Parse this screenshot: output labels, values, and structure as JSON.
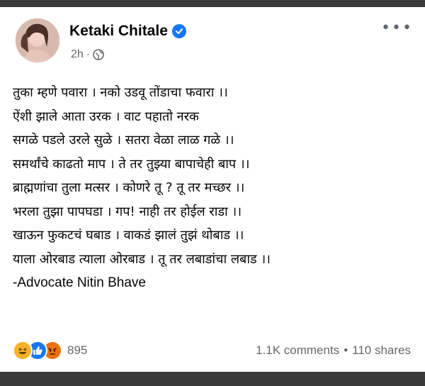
{
  "post": {
    "author": "Ketaki Chitale",
    "timestamp": "2h",
    "separator": "·",
    "more_label": "•••",
    "lines": [
      "तुका म्हणे पवारा । नको उडवू तोंडाचा फवारा ।।",
      "ऐंशी झाले आता उरक । वाट पहातो नरक",
      "सगळे पडले उरले सुळे । सतरा वेळा लाळ गळे ।।",
      "समर्थांचे काढतो माप । ते तर तुझ्या बापाचेही बाप ।।",
      "ब्राह्मणांचा तुला मत्सर । कोणरे तू ? तू तर  मच्छर ।।",
      "भरला तुझा पापघडा । गप! नाही तर होईल राडा ।।",
      "खाऊन  फुकटचं घबाड । वाकडं झालं तुझं थोबाड ।।",
      "याला ओरबाड त्याला ओरबाड ।  तू तर लबाडांचा लबाड ।।"
    ],
    "signature": "-Advocate Nitin Bhave"
  },
  "footer": {
    "reaction_count": "895",
    "comments": "1.1K comments",
    "bullet": "•",
    "shares": "110 shares"
  },
  "colors": {
    "verified": "#1877f2",
    "meta_text": "#65676b",
    "primary_text": "#050505"
  },
  "icons": [
    "verified-badge-icon",
    "globe-icon",
    "more-options-icon",
    "haha-reaction-icon",
    "like-reaction-icon",
    "angry-reaction-icon"
  ]
}
